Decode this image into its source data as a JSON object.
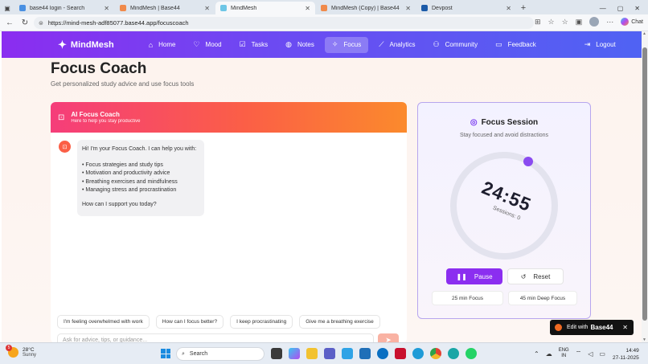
{
  "browser": {
    "tabs": [
      {
        "title": "base44 login - Search",
        "favicon_color": "#4a90e2",
        "active": false
      },
      {
        "title": "MindMesh | Base44",
        "favicon_color": "#f08a4b",
        "active": false
      },
      {
        "title": "MindMesh",
        "favicon_color": "#6ec6e6",
        "active": true
      },
      {
        "title": "MindMesh (Copy) | Base44",
        "favicon_color": "#f08a4b",
        "active": false
      },
      {
        "title": "Devpost",
        "favicon_color": "#1a5aa8",
        "active": false
      }
    ],
    "new_tab_symbol": "+",
    "url": "https://mind-mesh-adf85077.base44.app/focuscoach",
    "chat_label": "Chat"
  },
  "nav": {
    "brand": "MindMesh",
    "items": [
      {
        "label": "Home",
        "icon": "home-icon",
        "glyph": "⌂",
        "selected": false
      },
      {
        "label": "Mood",
        "icon": "heart-icon",
        "glyph": "♡",
        "selected": false
      },
      {
        "label": "Tasks",
        "icon": "checkbox-icon",
        "glyph": "☑",
        "selected": false
      },
      {
        "label": "Notes",
        "icon": "brain-icon",
        "glyph": "◍",
        "selected": false
      },
      {
        "label": "Focus",
        "icon": "sparkle-icon",
        "glyph": "✧",
        "selected": true
      },
      {
        "label": "Analytics",
        "icon": "trend-icon",
        "glyph": "⟋",
        "selected": false
      },
      {
        "label": "Community",
        "icon": "users-icon",
        "glyph": "⚇",
        "selected": false
      },
      {
        "label": "Feedback",
        "icon": "message-icon",
        "glyph": "▭",
        "selected": false
      }
    ],
    "logout": "Logout"
  },
  "page": {
    "title": "Focus Coach",
    "subtitle": "Get personalized study advice and use focus tools"
  },
  "coach": {
    "title": "AI Focus Coach",
    "subtitle": "Here to help you stay productive",
    "message": {
      "intro": "Hi! I'm your Focus Coach. I can help you with:",
      "bullets": [
        "• Focus strategies and study tips",
        "• Motivation and productivity advice",
        "• Breathing exercises and mindfulness",
        "• Managing stress and procrastination"
      ],
      "outro": "How can I support you today?"
    },
    "suggestions": [
      "I'm feeling overwhelmed with work",
      "How can I focus better?",
      "I keep procrastinating",
      "Give me a breathing exercise"
    ],
    "input_placeholder": "Ask for advice, tips, or guidance..."
  },
  "focus": {
    "title": "Focus Session",
    "subtitle": "Stay focused and avoid distractions",
    "time": "24:55",
    "sessions": "Sessions: 0",
    "pause": "Pause",
    "reset": "Reset",
    "preset1": "25 min Focus",
    "preset2": "45 min Deep Focus",
    "accent": "#8b2ef0"
  },
  "badge": {
    "prefix": "Edit with",
    "brand": "Base44"
  },
  "taskbar": {
    "temp": "28°C",
    "condition": "Sunny",
    "notification_count": "5",
    "search_label": "Search",
    "lang_line1": "ENG",
    "lang_line2": "IN",
    "time": "14:49",
    "date": "27-11-2025"
  }
}
